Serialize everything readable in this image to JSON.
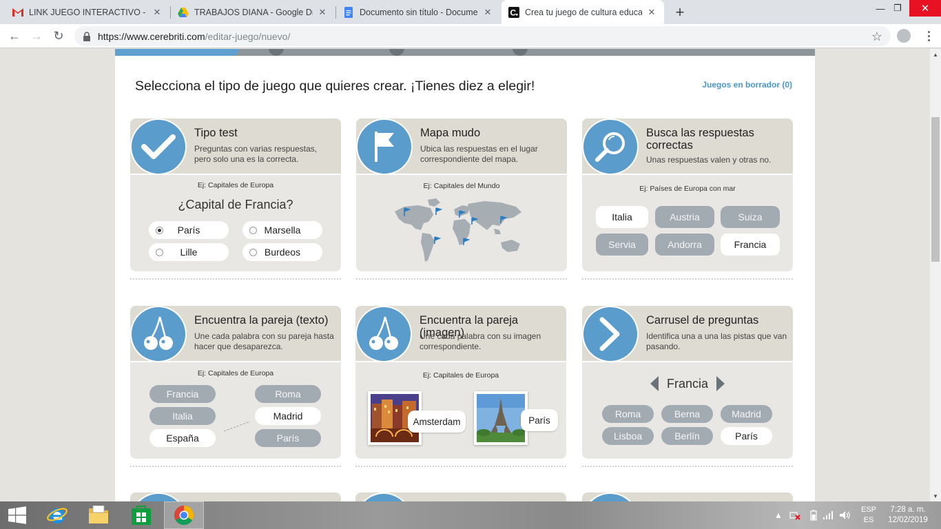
{
  "browser": {
    "tabs": [
      {
        "label": "LINK JUEGO INTERACTIVO - mpa",
        "icon": "gmail-icon"
      },
      {
        "label": "TRABAJOS DIANA - Google Drive",
        "icon": "google-drive-icon"
      },
      {
        "label": "Documento sin título - Documen",
        "icon": "google-docs-icon"
      },
      {
        "label": "Crea tu juego de cultura educativ",
        "icon": "cerebriti-icon"
      }
    ],
    "url_host": "https://www.cerebriti.com",
    "url_path": "/editar-juego/nuevo/"
  },
  "page": {
    "heading": "Selecciona el tipo de juego que quieres crear. ¡Tienes diez a elegir!",
    "drafts_link": "Juegos en borrador (0)",
    "cards": [
      {
        "title": "Tipo test",
        "desc": "Preguntas con varias respuestas, pero solo una es la correcta.",
        "example": "Ej: Capitales de Europa",
        "question": "¿Capital de Francia?",
        "options": [
          "París",
          "Marsella",
          "Lille",
          "Burdeos"
        ],
        "selected": "París"
      },
      {
        "title": "Mapa mudo",
        "desc": "Ubica las respuestas en el lugar correspondiente del mapa.",
        "example": "Ej: Capitales del Mundo"
      },
      {
        "title": "Busca las respuestas correctas",
        "desc": "Unas respuestas valen y otras no.",
        "example": "Ej: Países de Europa con mar",
        "options": [
          "Italia",
          "Austria",
          "Suiza",
          "Servia",
          "Andorra",
          "Francia"
        ]
      },
      {
        "title": "Encuentra la pareja (texto)",
        "desc": "Une cada palabra con su pareja hasta hacer que desaparezca.",
        "example": "Ej: Capitales de Europa",
        "left": [
          "Francia",
          "Italia",
          "España"
        ],
        "right": [
          "Roma",
          "Madrid",
          "París"
        ]
      },
      {
        "title": "Encuentra la pareja (imagen)",
        "desc": "Une cada palabra con su imagen correspondiente.",
        "example": "Ej: Capitales de Europa",
        "labels": [
          "Amsterdam",
          "París"
        ]
      },
      {
        "title": "Carrusel de preguntas",
        "desc": "Identifica una a una las pistas que van pasando.",
        "current": "Francia",
        "options": [
          "Roma",
          "Berna",
          "Madrid",
          "Lisboa",
          "Berlín",
          "París"
        ]
      }
    ]
  },
  "taskbar": {
    "lang_top": "ESP",
    "lang_bottom": "ES",
    "time": "7:28 a. m.",
    "date": "12/02/2019"
  },
  "colors": {
    "accent_blue": "#5a9ccc",
    "card_bg": "#e8e7e3",
    "card_head": "#dedbd2",
    "pill_grey": "#a2abb2",
    "link_blue": "#4a97c9"
  }
}
